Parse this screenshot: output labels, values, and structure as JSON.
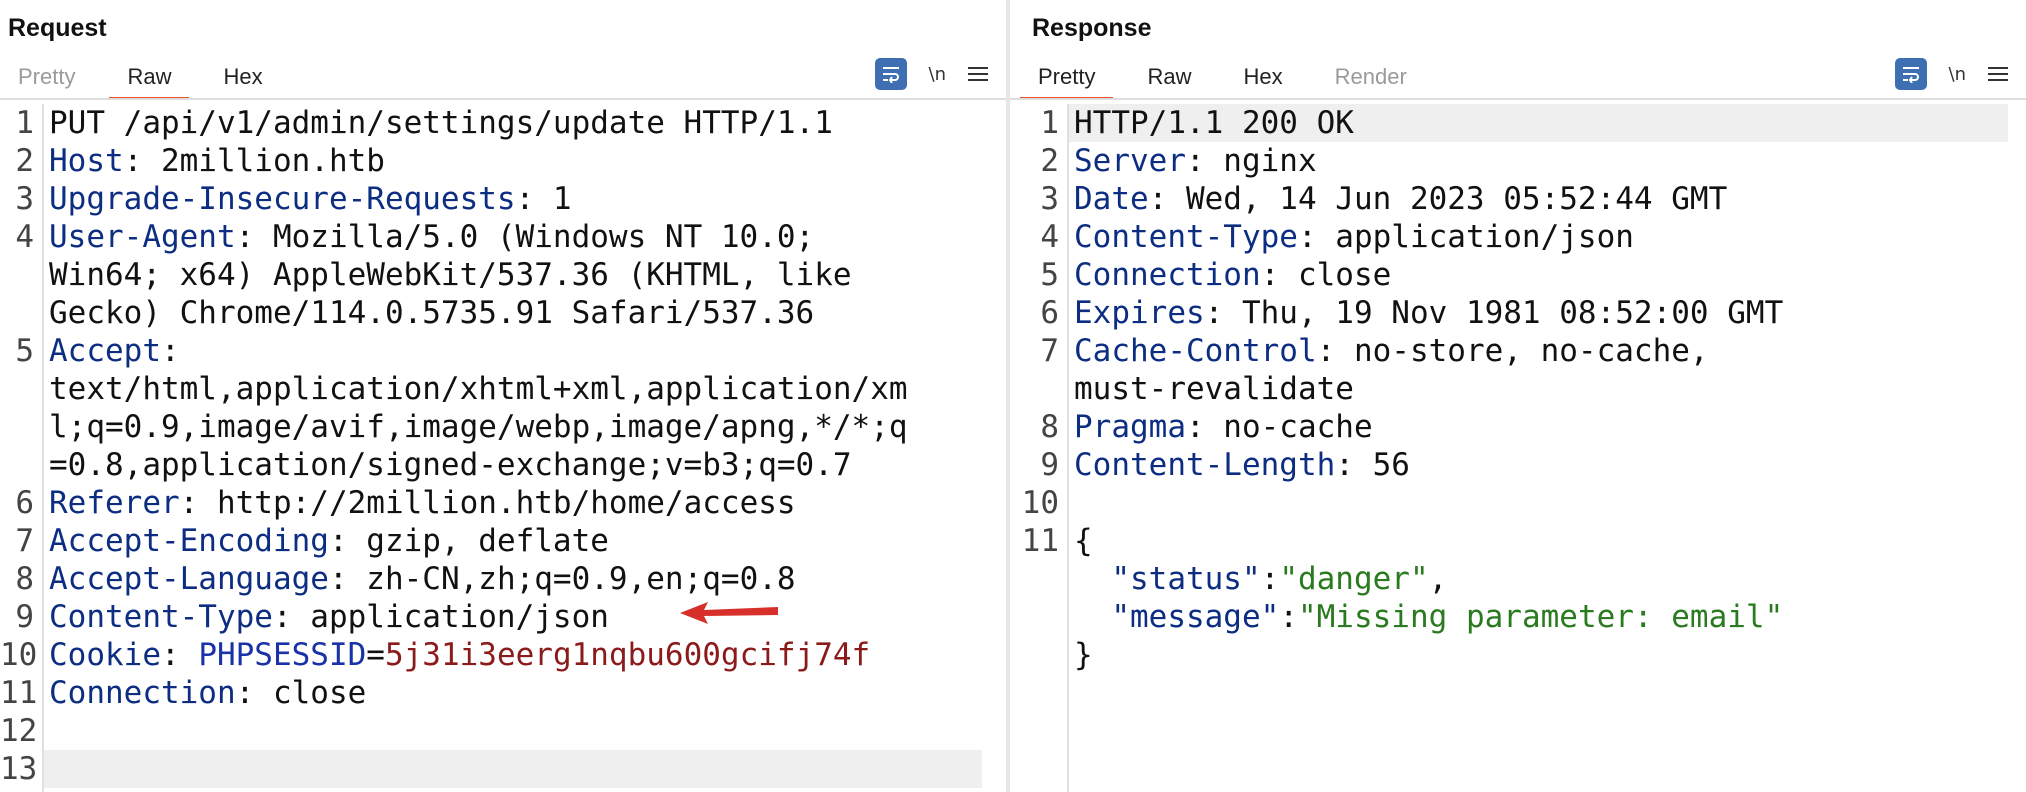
{
  "request": {
    "title": "Request",
    "tabs": [
      "Pretty",
      "Raw",
      "Hex"
    ],
    "active_tab": "Raw",
    "newline_label": "\\n",
    "lines": [
      {
        "n": "1",
        "parts": [
          {
            "t": "PUT /api/v1/admin/settings/update HTTP/1.1",
            "c": ""
          }
        ]
      },
      {
        "n": "2",
        "parts": [
          {
            "t": "Host",
            "c": "k"
          },
          {
            "t": ": 2million.htb",
            "c": ""
          }
        ]
      },
      {
        "n": "3",
        "parts": [
          {
            "t": "Upgrade-Insecure-Requests",
            "c": "k"
          },
          {
            "t": ": 1",
            "c": ""
          }
        ]
      },
      {
        "n": "4",
        "parts": [
          {
            "t": "User-Agent",
            "c": "k"
          },
          {
            "t": ": Mozilla/5.0 (Windows NT 10.0;",
            "c": ""
          }
        ]
      },
      {
        "n": "",
        "parts": [
          {
            "t": "Win64; x64) AppleWebKit/537.36 (KHTML, like",
            "c": ""
          }
        ]
      },
      {
        "n": "",
        "parts": [
          {
            "t": "Gecko) Chrome/114.0.5735.91 Safari/537.36",
            "c": ""
          }
        ]
      },
      {
        "n": "5",
        "parts": [
          {
            "t": "Accept",
            "c": "k"
          },
          {
            "t": ":",
            "c": ""
          }
        ]
      },
      {
        "n": "",
        "parts": [
          {
            "t": "text/html,application/xhtml+xml,application/xm",
            "c": ""
          }
        ]
      },
      {
        "n": "",
        "parts": [
          {
            "t": "l;q=0.9,image/avif,image/webp,image/apng,*/*;q",
            "c": ""
          }
        ]
      },
      {
        "n": "",
        "parts": [
          {
            "t": "=0.8,application/signed-exchange;v=b3;q=0.7",
            "c": ""
          }
        ]
      },
      {
        "n": "6",
        "parts": [
          {
            "t": "Referer",
            "c": "k"
          },
          {
            "t": ": http://2million.htb/home/access",
            "c": ""
          }
        ]
      },
      {
        "n": "7",
        "parts": [
          {
            "t": "Accept-Encoding",
            "c": "k"
          },
          {
            "t": ": gzip, deflate",
            "c": ""
          }
        ]
      },
      {
        "n": "8",
        "parts": [
          {
            "t": "Accept-Language",
            "c": "k"
          },
          {
            "t": ": zh-CN,zh;q=0.9,en;q=0.8",
            "c": ""
          }
        ]
      },
      {
        "n": "9",
        "parts": [
          {
            "t": "Content-Type",
            "c": "k"
          },
          {
            "t": ": application/json",
            "c": ""
          }
        ]
      },
      {
        "n": "10",
        "parts": [
          {
            "t": "Cookie",
            "c": "k"
          },
          {
            "t": ": ",
            "c": ""
          },
          {
            "t": "PHPSESSID",
            "c": "ck"
          },
          {
            "t": "=",
            "c": ""
          },
          {
            "t": "5j31i3eerg1nqbu600gcifj74f",
            "c": "cv"
          }
        ]
      },
      {
        "n": "11",
        "parts": [
          {
            "t": "Connection",
            "c": "k"
          },
          {
            "t": ": close",
            "c": ""
          }
        ]
      },
      {
        "n": "12",
        "parts": [
          {
            "t": "",
            "c": ""
          }
        ]
      },
      {
        "n": "13",
        "parts": [
          {
            "t": "",
            "c": ""
          }
        ],
        "highlight": true
      }
    ]
  },
  "response": {
    "title": "Response",
    "tabs": [
      "Pretty",
      "Raw",
      "Hex",
      "Render"
    ],
    "active_tab": "Pretty",
    "muted_tabs": [
      "Render"
    ],
    "newline_label": "\\n",
    "lines": [
      {
        "n": "1",
        "parts": [
          {
            "t": "HTTP/1.1 200 OK",
            "c": ""
          }
        ],
        "highlight": true
      },
      {
        "n": "2",
        "parts": [
          {
            "t": "Server",
            "c": "k"
          },
          {
            "t": ": nginx",
            "c": ""
          }
        ]
      },
      {
        "n": "3",
        "parts": [
          {
            "t": "Date",
            "c": "k"
          },
          {
            "t": ": Wed, 14 Jun 2023 05:52:44 GMT",
            "c": ""
          }
        ]
      },
      {
        "n": "4",
        "parts": [
          {
            "t": "Content-Type",
            "c": "k"
          },
          {
            "t": ": application/json",
            "c": ""
          }
        ]
      },
      {
        "n": "5",
        "parts": [
          {
            "t": "Connection",
            "c": "k"
          },
          {
            "t": ": close",
            "c": ""
          }
        ]
      },
      {
        "n": "6",
        "parts": [
          {
            "t": "Expires",
            "c": "k"
          },
          {
            "t": ": Thu, 19 Nov 1981 08:52:00 GMT",
            "c": ""
          }
        ]
      },
      {
        "n": "7",
        "parts": [
          {
            "t": "Cache-Control",
            "c": "k"
          },
          {
            "t": ": no-store, no-cache,",
            "c": ""
          }
        ]
      },
      {
        "n": "",
        "parts": [
          {
            "t": "must-revalidate",
            "c": ""
          }
        ]
      },
      {
        "n": "8",
        "parts": [
          {
            "t": "Pragma",
            "c": "k"
          },
          {
            "t": ": no-cache",
            "c": ""
          }
        ]
      },
      {
        "n": "9",
        "parts": [
          {
            "t": "Content-Length",
            "c": "k"
          },
          {
            "t": ": 56",
            "c": ""
          }
        ]
      },
      {
        "n": "10",
        "parts": [
          {
            "t": "",
            "c": ""
          }
        ]
      },
      {
        "n": "11",
        "parts": [
          {
            "t": "{",
            "c": ""
          }
        ]
      },
      {
        "n": "",
        "parts": [
          {
            "t": "  \"status\"",
            "c": "k"
          },
          {
            "t": ":",
            "c": ""
          },
          {
            "t": "\"danger\"",
            "c": "s"
          },
          {
            "t": ",",
            "c": ""
          }
        ]
      },
      {
        "n": "",
        "parts": [
          {
            "t": "  \"message\"",
            "c": "k"
          },
          {
            "t": ":",
            "c": ""
          },
          {
            "t": "\"Missing parameter: email\"",
            "c": "s"
          }
        ]
      },
      {
        "n": "",
        "parts": [
          {
            "t": "}",
            "c": ""
          }
        ]
      }
    ]
  },
  "colors": {
    "accent_tab": "#e8532d",
    "tool_blue": "#3d6fb2",
    "header_key": "#0c2d82",
    "cookie_value": "#8b1a1a",
    "json_string": "#2a7a1f",
    "annotation_arrow": "#d7302a"
  },
  "icons": {
    "wrap_toggle": "word-wrap-icon",
    "menu": "hamburger-menu-icon",
    "annotation": "red-arrow-icon",
    "layout": [
      "layout-side-by-side-icon",
      "layout-stacked-icon",
      "layout-single-icon"
    ]
  }
}
